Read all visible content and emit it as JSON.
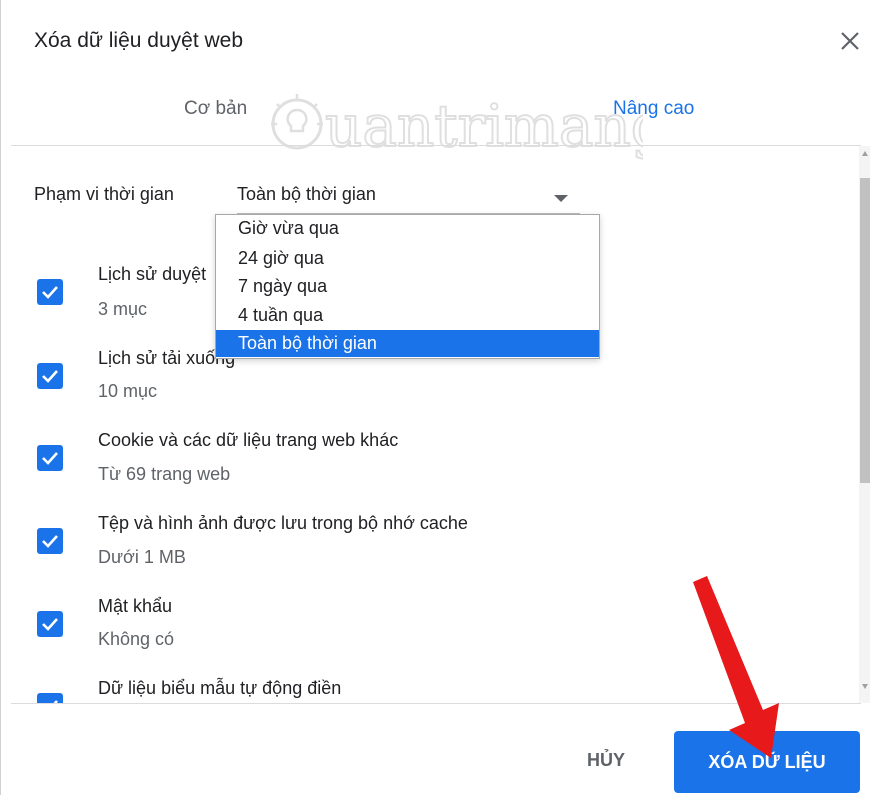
{
  "dialog": {
    "title": "Xóa dữ liệu duyệt web",
    "tabs": [
      {
        "label": "Cơ bản",
        "active": false
      },
      {
        "label": "Nâng cao",
        "active": true
      }
    ],
    "accent_color": "#1a73e8"
  },
  "time_range": {
    "label": "Phạm vi thời gian",
    "selected": "Toàn bộ thời gian",
    "options": [
      "Giờ vừa qua",
      "24 giờ qua",
      "7 ngày qua",
      "4 tuần qua",
      "Toàn bộ thời gian"
    ]
  },
  "items": [
    {
      "title": "Lịch sử duyệt",
      "subtitle": "3 mục",
      "checked": true
    },
    {
      "title": "Lịch sử tải xuống",
      "subtitle": "10 mục",
      "checked": true
    },
    {
      "title": "Cookie và các dữ liệu trang web khác",
      "subtitle": "Từ 69 trang web",
      "checked": true
    },
    {
      "title": "Tệp và hình ảnh được lưu trong bộ nhớ cache",
      "subtitle": "Dưới 1 MB",
      "checked": true
    },
    {
      "title": "Mật khẩu",
      "subtitle": "Không có",
      "checked": true
    },
    {
      "title": "Dữ liệu biểu mẫu tự động điền",
      "subtitle": "",
      "checked": true
    }
  ],
  "footer": {
    "cancel_label": "HỦY",
    "clear_label": "XÓA DỮ LIỆU"
  },
  "watermark": {
    "text": "uantrimang",
    "icon": "lightbulb-icon"
  },
  "annotation": {
    "icon": "red-arrow-icon",
    "color": "#e8191a"
  }
}
